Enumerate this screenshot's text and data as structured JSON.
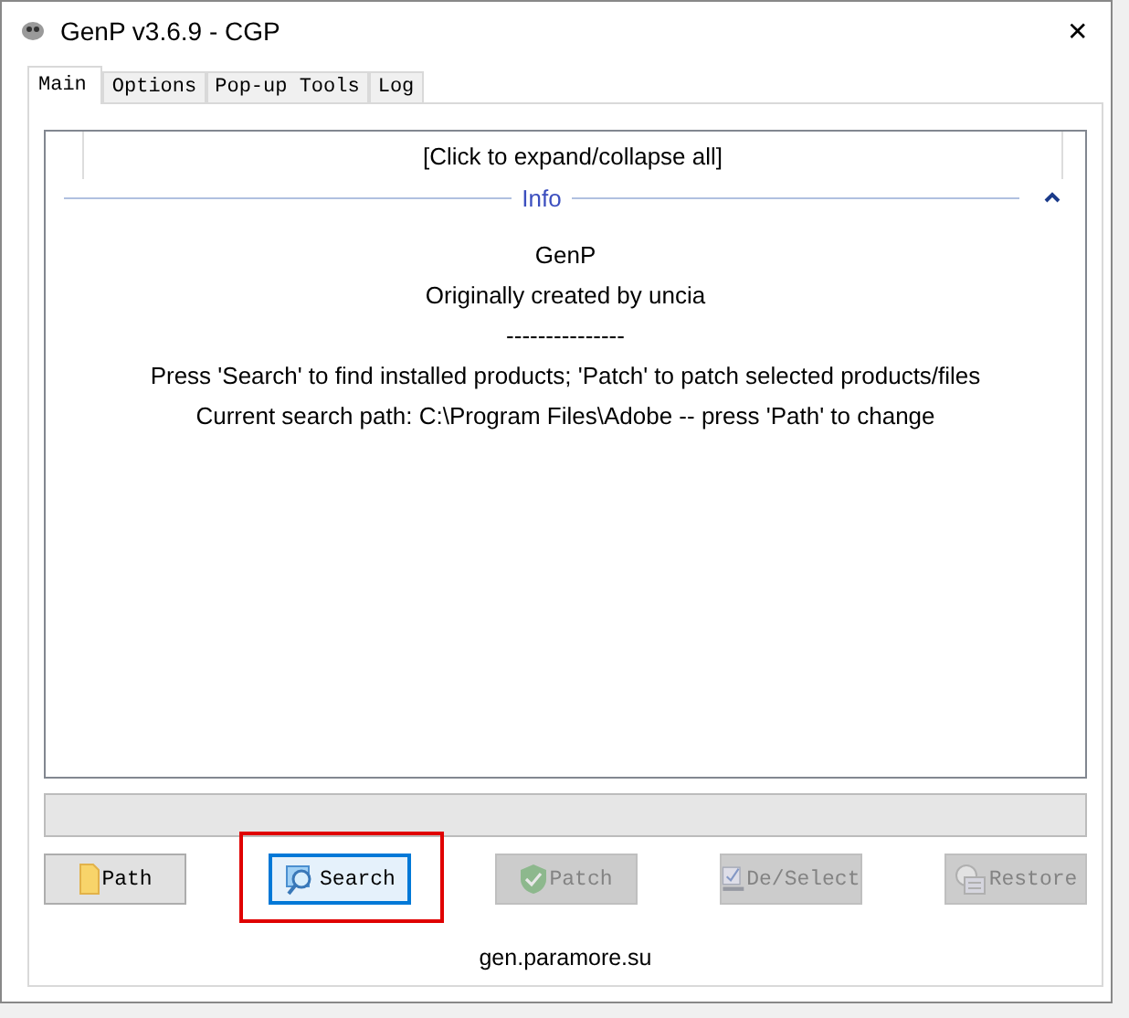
{
  "window": {
    "title": "GenP v3.6.9 - CGP",
    "close": "✕"
  },
  "tabs": [
    {
      "label": "Main",
      "selected": true
    },
    {
      "label": "Options",
      "selected": false
    },
    {
      "label": "Pop-up Tools",
      "selected": false
    },
    {
      "label": "Log",
      "selected": false
    }
  ],
  "panel": {
    "header": "[Click to expand/collapse all]",
    "group": {
      "title": "Info",
      "expanded": true
    },
    "lines": [
      "GenP",
      "Originally created by uncia",
      "---------------",
      "Press 'Search' to find installed products; 'Patch' to patch selected products/files",
      "Current search path: C:\\Program Files\\Adobe -- press 'Path' to change"
    ]
  },
  "progress": {
    "level": 0
  },
  "buttons": [
    {
      "kind": "folder",
      "label": "Path",
      "disabled": false,
      "focused": false,
      "highlighted": false
    },
    {
      "kind": "search",
      "label": "Search",
      "disabled": false,
      "focused": true,
      "highlighted": true
    },
    {
      "kind": "shield",
      "label": "Patch",
      "disabled": true,
      "focused": false,
      "highlighted": false
    },
    {
      "kind": "checklist",
      "label": "De/Select",
      "disabled": true,
      "focused": false,
      "highlighted": false
    },
    {
      "kind": "restore",
      "label": "Restore",
      "disabled": true,
      "focused": false,
      "highlighted": false
    }
  ],
  "footer": "gen.paramore.su"
}
